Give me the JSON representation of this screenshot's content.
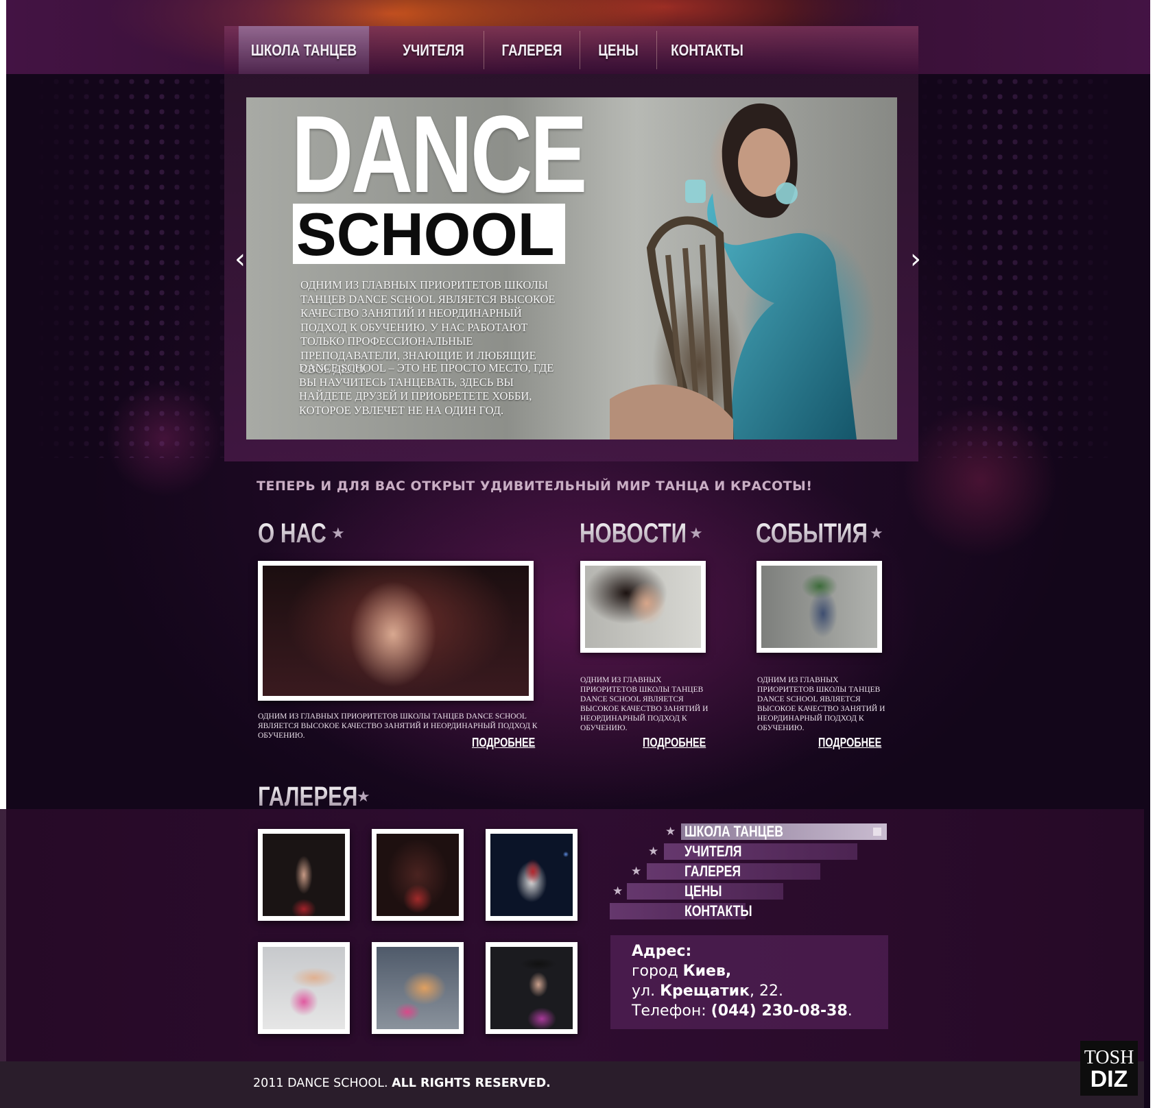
{
  "nav": {
    "items": [
      "ШКОЛА ТАНЦЕВ",
      "УЧИТЕЛЯ",
      "ГАЛЕРЕЯ",
      "ЦЕНЫ",
      "КОНТАКТЫ"
    ],
    "active_index": 0
  },
  "hero": {
    "title_top": "DANCE",
    "title_bottom": "SCHOOL",
    "paragraph1": "Одним из главных приоритетов школы танцев DANCE SCHOOL является высокое качество занятий и неординарный подход к обучению. У нас работают только профессиональные преподаватели, знающие и любящие свое дело.",
    "paragraph2": "DANCE SCHOOL – это не просто место, где вы научитесь танцевать, здесь Вы найдете друзей и приобретете хобби, которое увлечет не на один год.",
    "prev_arrow": "‹",
    "next_arrow": "›",
    "arrow_icons": [
      "chevron-left-icon",
      "chevron-right-icon"
    ]
  },
  "tagline": "ТЕПЕРЬ И ДЛЯ ВАС ОТКРЫТ УДИВИТЕЛЬНЫЙ МИР ТАНЦА И КРАСОТЫ!",
  "sections": {
    "about": {
      "title": "О НАС",
      "text": "Одним из главных приоритетов школы танцев DANCE SCHOOL является высокое качество занятий и неординарный подход к обучению.",
      "more": "ПОДРОБНЕЕ"
    },
    "news": {
      "title": "НОВОСТИ",
      "text": "Одним из главных приоритетов школы танцев DANCE SCHOOL является высокое качество занятий и неординарный подход к обучению.",
      "more": "ПОДРОБНЕЕ"
    },
    "events": {
      "title": "СОБЫТИЯ",
      "text": "Одним из главных приоритетов школы танцев DANCE SCHOOL является высокое качество занятий и неординарный подход к обучению.",
      "more": "ПОДРОБНЕЕ"
    }
  },
  "gallery": {
    "title": "ГАЛЕРЕЯ"
  },
  "footer_menu": {
    "items": [
      "ШКОЛА ТАНЦЕВ",
      "УЧИТЕЛЯ",
      "ГАЛЕРЕЯ",
      "ЦЕНЫ",
      "КОНТАКТЫ"
    ]
  },
  "address": {
    "label": "Адрес:",
    "city_prefix": "город ",
    "city": "Киев,",
    "street_prefix": "ул. ",
    "street": "Крещатик",
    "street_suffix": ", 22.",
    "phone_prefix": "Телефон: ",
    "phone": "(044) 230-08-38",
    "phone_suffix": "."
  },
  "footer": {
    "copyright_year": "2011 DANCE SCHOOL.",
    "rights": "ALL RIGHTS RESERVED."
  },
  "badge": {
    "line1": "TOSH",
    "line2": "DIZ"
  },
  "colors": {
    "accent_purple": "#2a0d2e",
    "nav_orange_glow": "#e65f1e",
    "footer_bg": "#2a1d2b"
  }
}
